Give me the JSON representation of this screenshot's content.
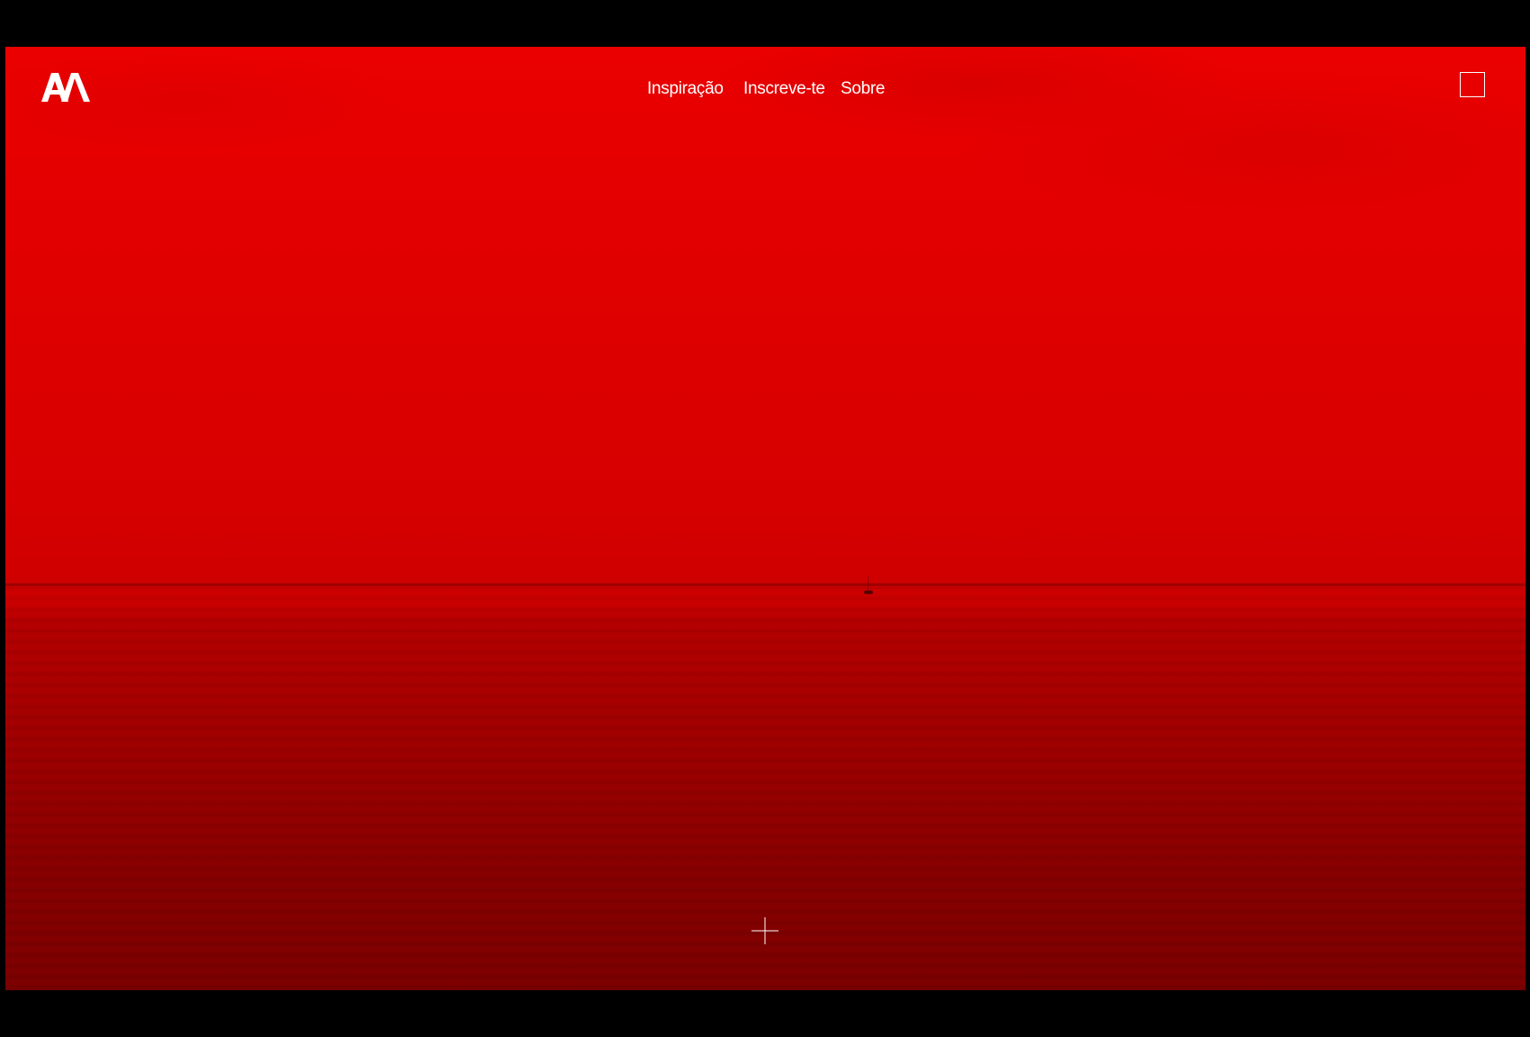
{
  "brand": {
    "logo_text": "AA",
    "logo_icon": "aa-monogram-icon"
  },
  "nav": {
    "items": [
      {
        "label": "Inspiração"
      },
      {
        "label": "Inscreve-te"
      },
      {
        "label": "Sobre"
      }
    ]
  },
  "menu": {
    "icon": "square-menu-icon"
  },
  "hero": {
    "image": "red-tinted-sea-horizon",
    "cursor_icon": "crosshair-icon"
  },
  "colors": {
    "accent": "#e60000",
    "text": "#ffffff",
    "frame_background": "#000000"
  }
}
